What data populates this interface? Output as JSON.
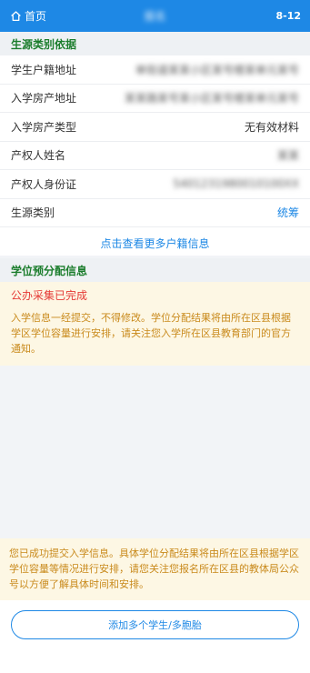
{
  "topbar": {
    "home_label": "首页",
    "title": "报名",
    "date": "8-12",
    "bg_color": "#1e88e5"
  },
  "source_section": {
    "heading": "生源类别依据",
    "rows": [
      {
        "label": "学生户籍地址",
        "value": "单街道某某小区某号楼某单元某号",
        "blurred": true
      },
      {
        "label": "入学房产地址",
        "value": "某某路某号某小区某号楼某单元某号",
        "blurred": true
      },
      {
        "label": "入学房产类型",
        "value": "无有效材料",
        "blurred": false
      },
      {
        "label": "产权人姓名",
        "value": "某某",
        "blurred": true
      },
      {
        "label": "产权人身份证",
        "value": "5401231980010100XX",
        "blurred": true
      },
      {
        "label": "生源类别",
        "value": "统筹",
        "blurred": false,
        "link": true
      }
    ],
    "more_link": "点击查看更多户籍信息"
  },
  "allocation_section": {
    "heading": "学位预分配信息",
    "status": "公办采集已完成",
    "notice": "入学信息一经提交，不得修改。学位分配结果将由所在区县根据学区学位容量进行安排，请关注您入学所在区县教育部门的官方通知。"
  },
  "bottom_notice": "您已成功提交入学信息。具体学位分配结果将由所在区县根据学区学位容量等情况进行安排，请您关注您报名所在区县的教体局公众号以方便了解具体时间和安排。",
  "add_button": "添加多个学生/多胞胎",
  "colors": {
    "accent": "#1e88e5",
    "heading_green": "#1b7d2c",
    "warn_red": "#e53935",
    "notice_text": "#c98a1c"
  }
}
